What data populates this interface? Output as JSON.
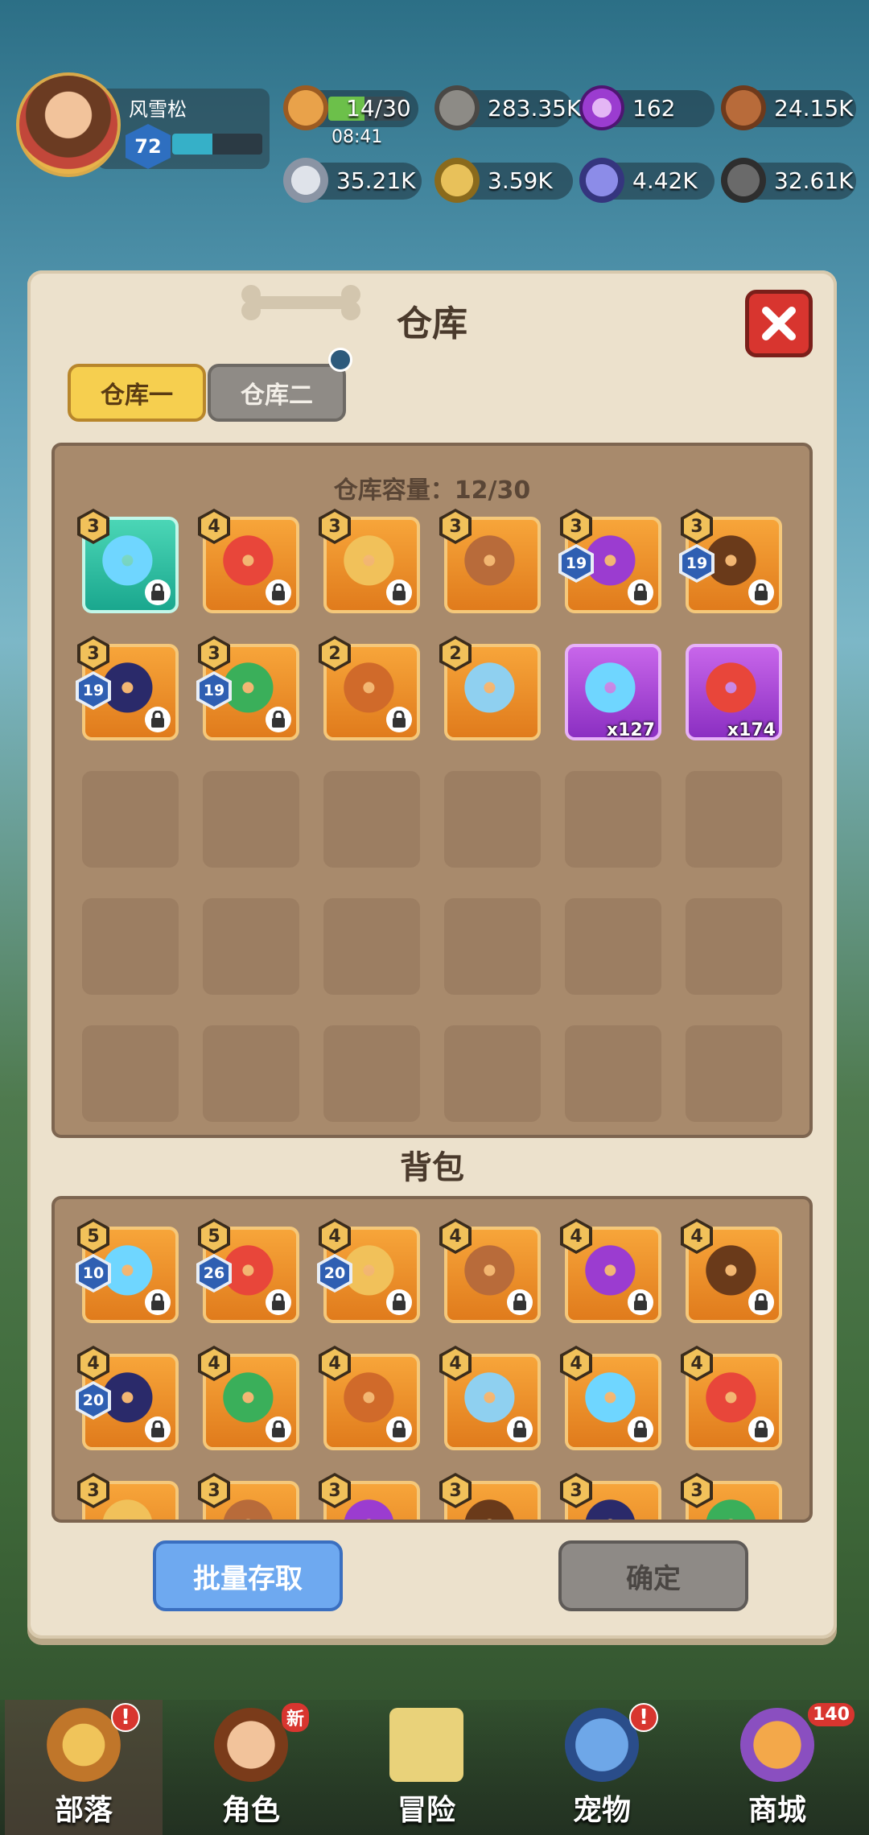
{
  "player": {
    "name": "风雪松",
    "level": "72",
    "xp_fraction": 0.45
  },
  "stamina": {
    "value": "14/30",
    "timer": "08:41",
    "fraction": 0.47
  },
  "resources_row1": [
    {
      "icon": "meat-icon",
      "value": ""
    },
    {
      "icon": "stone-icon",
      "value": "283.35K"
    },
    {
      "icon": "purple-orb-icon",
      "value": "162"
    },
    {
      "icon": "wood-logs-icon",
      "value": "24.15K"
    }
  ],
  "resources_row2": [
    {
      "icon": "bone-icon",
      "value": "35.21K"
    },
    {
      "icon": "gold-nugget-icon",
      "value": "3.59K"
    },
    {
      "icon": "blue-crystal-icon",
      "value": "4.42K"
    },
    {
      "icon": "iron-ore-icon",
      "value": "32.61K"
    }
  ],
  "panel": {
    "title": "仓库"
  },
  "tabs": [
    {
      "label": "仓库一"
    },
    {
      "label": "仓库二"
    }
  ],
  "warehouse": {
    "capacity_text": "仓库容量：12/30",
    "items": [
      {
        "level": "3",
        "enh": "",
        "qty": "",
        "color": "teal",
        "icon": "dragon-ring-icon",
        "locked": true
      },
      {
        "level": "4",
        "enh": "",
        "qty": "",
        "color": "orange",
        "icon": "crimson-bow-icon",
        "locked": true
      },
      {
        "level": "3",
        "enh": "",
        "qty": "",
        "color": "orange",
        "icon": "vine-bow-icon",
        "locked": true
      },
      {
        "level": "3",
        "enh": "",
        "qty": "",
        "color": "orange",
        "icon": "stone-hammer-icon",
        "locked": false
      },
      {
        "level": "3",
        "enh": "19",
        "qty": "",
        "color": "orange",
        "icon": "crossbow-icon",
        "locked": true
      },
      {
        "level": "3",
        "enh": "19",
        "qty": "",
        "color": "orange",
        "icon": "leather-pants-icon",
        "locked": true
      },
      {
        "level": "3",
        "enh": "19",
        "qty": "",
        "color": "orange",
        "icon": "star-necklace-icon",
        "locked": true
      },
      {
        "level": "3",
        "enh": "19",
        "qty": "",
        "color": "orange",
        "icon": "skull-amulet-icon",
        "locked": true
      },
      {
        "level": "2",
        "enh": "",
        "qty": "",
        "color": "orange",
        "icon": "hood-icon",
        "locked": true
      },
      {
        "level": "2",
        "enh": "",
        "qty": "",
        "color": "orange",
        "icon": "shorts-icon",
        "locked": false
      },
      {
        "level": "",
        "enh": "",
        "qty": "x127",
        "color": "purple",
        "icon": "boot-material-icon",
        "locked": false
      },
      {
        "level": "",
        "enh": "",
        "qty": "x174",
        "color": "purple",
        "icon": "boot-material-icon",
        "locked": false
      }
    ]
  },
  "bag": {
    "title": "背包",
    "items": [
      {
        "level": "5",
        "enh": "10",
        "color": "orange",
        "icon": "gauntlet-icon",
        "locked": true
      },
      {
        "level": "5",
        "enh": "26",
        "color": "orange",
        "icon": "goggles-icon",
        "locked": true
      },
      {
        "level": "4",
        "enh": "20",
        "color": "orange",
        "icon": "dark-bow-icon",
        "locked": true
      },
      {
        "level": "4",
        "enh": "",
        "color": "orange",
        "icon": "battle-axe-icon",
        "locked": true
      },
      {
        "level": "4",
        "enh": "",
        "color": "orange",
        "icon": "horned-helmet-icon",
        "locked": true
      },
      {
        "level": "4",
        "enh": "",
        "color": "orange",
        "icon": "spiked-pauldron-icon",
        "locked": true
      },
      {
        "level": "4",
        "enh": "20",
        "color": "orange",
        "icon": "leaf-blade-icon",
        "locked": true
      },
      {
        "level": "4",
        "enh": "",
        "color": "orange",
        "icon": "purple-armor-icon",
        "locked": true
      },
      {
        "level": "4",
        "enh": "",
        "color": "orange",
        "icon": "red-boots-icon",
        "locked": true
      },
      {
        "level": "4",
        "enh": "",
        "color": "orange",
        "icon": "lens-goggles-icon",
        "locked": true
      },
      {
        "level": "4",
        "enh": "",
        "color": "orange",
        "icon": "crown-ring-icon",
        "locked": true
      },
      {
        "level": "4",
        "enh": "",
        "color": "orange",
        "icon": "ruby-pendant-icon",
        "locked": true
      },
      {
        "level": "3",
        "enh": "",
        "color": "orange",
        "icon": "gem-icon",
        "locked": false
      },
      {
        "level": "3",
        "enh": "",
        "color": "orange",
        "icon": "potion-icon",
        "locked": false
      },
      {
        "level": "3",
        "enh": "",
        "color": "orange",
        "icon": "horn-icon",
        "locked": false
      },
      {
        "level": "3",
        "enh": "",
        "color": "orange",
        "icon": "green-helm-icon",
        "locked": false
      },
      {
        "level": "3",
        "enh": "",
        "color": "orange",
        "icon": "blue-orb-icon",
        "locked": false
      },
      {
        "level": "3",
        "enh": "",
        "color": "orange",
        "icon": "spike-ball-icon",
        "locked": false
      }
    ]
  },
  "buttons": {
    "batch": "批量存取",
    "confirm": "确定"
  },
  "nav": [
    {
      "label": "部落",
      "badge": "!",
      "icon": "tribe-icon"
    },
    {
      "label": "角色",
      "badge": "新",
      "icon": "character-icon"
    },
    {
      "label": "冒险",
      "badge": "",
      "icon": "map-icon"
    },
    {
      "label": "宠物",
      "badge": "!",
      "icon": "pet-icon"
    },
    {
      "label": "商城",
      "badge": "140",
      "icon": "shop-icon"
    }
  ],
  "colors": {
    "accent": "#f6cf4f",
    "panel": "#ece1cc",
    "close": "#d8352f",
    "batch_button": "#6ea9f0"
  }
}
